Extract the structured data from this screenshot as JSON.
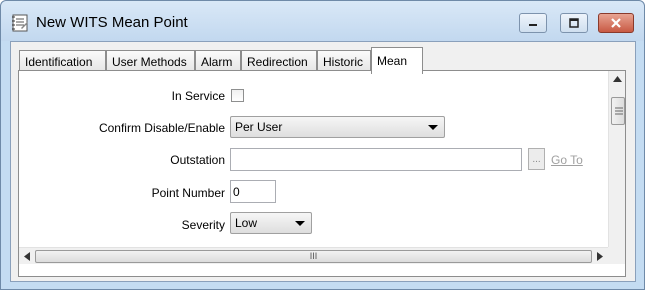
{
  "window": {
    "title": "New WITS Mean Point"
  },
  "tabs": [
    {
      "label": "Identification"
    },
    {
      "label": "User Methods"
    },
    {
      "label": "Alarm"
    },
    {
      "label": "Redirection"
    },
    {
      "label": "Historic"
    },
    {
      "label": "Mean"
    }
  ],
  "active_tab": "Mean",
  "form": {
    "in_service": {
      "label": "In Service",
      "checked": false
    },
    "confirm_disable_enable": {
      "label": "Confirm Disable/Enable",
      "value": "Per User"
    },
    "outstation": {
      "label": "Outstation",
      "value": "",
      "browse_label": "...",
      "goto_label": "Go To"
    },
    "point_number": {
      "label": "Point Number",
      "value": "0"
    },
    "severity": {
      "label": "Severity",
      "value": "Low"
    }
  },
  "scroll": {
    "hthumb_grip": "III"
  },
  "colors": {
    "accent_frame": "#c4dcf2",
    "close_button": "#c85a44",
    "disabled_link": "#a0a0a0"
  }
}
